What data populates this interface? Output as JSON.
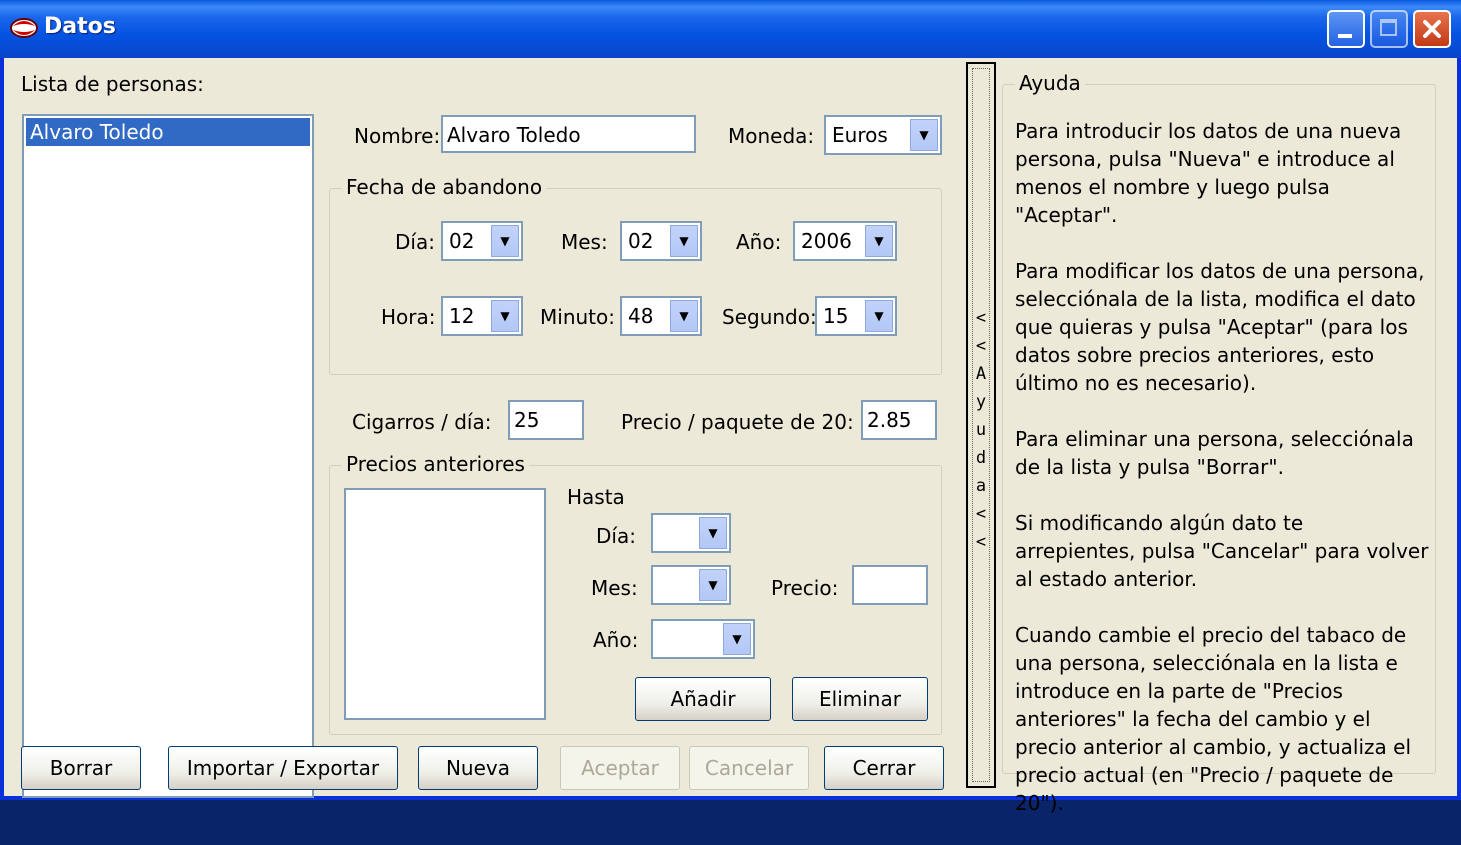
{
  "window": {
    "title": "Datos"
  },
  "left": {
    "list_label": "Lista de personas:",
    "persons": [
      "Alvaro Toledo"
    ]
  },
  "form": {
    "nombre_label": "Nombre:",
    "nombre_value": "Alvaro Toledo",
    "moneda_label": "Moneda:",
    "moneda_value": "Euros",
    "fecha_group": "Fecha de abandono",
    "dia_label": "Día:",
    "dia_value": "02",
    "mes_label": "Mes:",
    "mes_value": "02",
    "anio_label": "Año:",
    "anio_value": "2006",
    "hora_label": "Hora:",
    "hora_value": "12",
    "minuto_label": "Minuto:",
    "minuto_value": "48",
    "segundo_label": "Segundo:",
    "segundo_value": "15",
    "cigarros_label": "Cigarros / día:",
    "cigarros_value": "25",
    "precio_label": "Precio / paquete de 20:",
    "precio_value": "2.85"
  },
  "precios": {
    "group": "Precios anteriores",
    "hasta_label": "Hasta",
    "dia_label": "Día:",
    "mes_label": "Mes:",
    "anio_label": "Año:",
    "precio_label": "Precio:",
    "add_button": "Añadir",
    "remove_button": "Eliminar"
  },
  "buttons": {
    "borrar": "Borrar",
    "importar": "Importar / Exportar",
    "nueva": "Nueva",
    "aceptar": "Aceptar",
    "cancelar": "Cancelar",
    "cerrar": "Cerrar"
  },
  "splitter": {
    "label": "<<Ayuda<<"
  },
  "help": {
    "title": "Ayuda",
    "paragraphs": [
      "Para introducir los datos de una nueva persona, pulsa \"Nueva\" e introduce al menos el nombre y luego pulsa \"Aceptar\".",
      "Para modificar los datos de una persona, selecciónala de la lista, modifica el dato que quieras y pulsa \"Aceptar\" (para los datos sobre precios anteriores, esto último no es necesario).",
      "Para eliminar una persona, selecciónala de la lista y pulsa \"Borrar\".",
      "Si modificando algún dato te arrepientes, pulsa \"Cancelar\" para volver al estado anterior.",
      "Cuando cambie el precio del tabaco de una persona, selecciónala en la lista e introduce en la parte de \"Precios anteriores\" la fecha del cambio y el precio anterior al cambio, y actualiza el precio actual (en \"Precio / paquete de 20\")."
    ]
  },
  "colors": {
    "titlebar": "#0553E3",
    "client": "#ECE9D8",
    "selection": "#316AC5",
    "close": "#C23A14"
  }
}
